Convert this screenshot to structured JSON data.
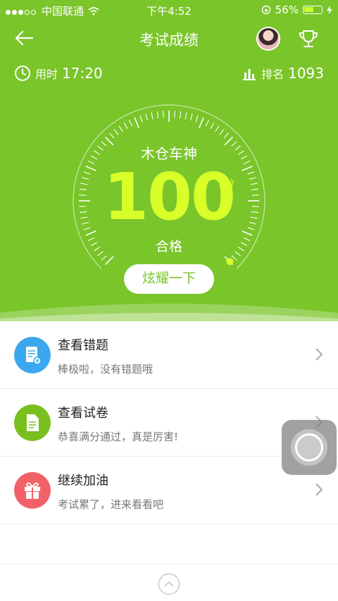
{
  "status": {
    "carrier": "中国联通",
    "time": "下午4:52",
    "battery": "56%",
    "battery_level": 0.56
  },
  "header": {
    "title": "考试成绩",
    "back_icon": "arrow-left-icon",
    "trophy_icon": "trophy-icon"
  },
  "meta": {
    "time_label": "用时",
    "time_value": "17:20",
    "rank_label": "排名",
    "rank_value": "1093"
  },
  "result": {
    "username": "木仓车神",
    "score": "100",
    "unit": "分",
    "status": "合格",
    "share_label": "炫耀一下",
    "gauge_fraction": 1.0
  },
  "actions": [
    {
      "title": "查看错题",
      "subtitle": "棒极啦，没有错题哦",
      "icon": "wrong-questions-icon",
      "color": "#3ba7ee"
    },
    {
      "title": "查看试卷",
      "subtitle": "恭喜满分通过，真是厉害!",
      "icon": "exam-paper-icon",
      "color": "#79c01e"
    },
    {
      "title": "继续加油",
      "subtitle": "考试累了，进来看看吧",
      "icon": "gift-icon",
      "color": "#f26168"
    }
  ],
  "colors": {
    "primary": "#7ac52a",
    "score": "#d8ff2a"
  }
}
